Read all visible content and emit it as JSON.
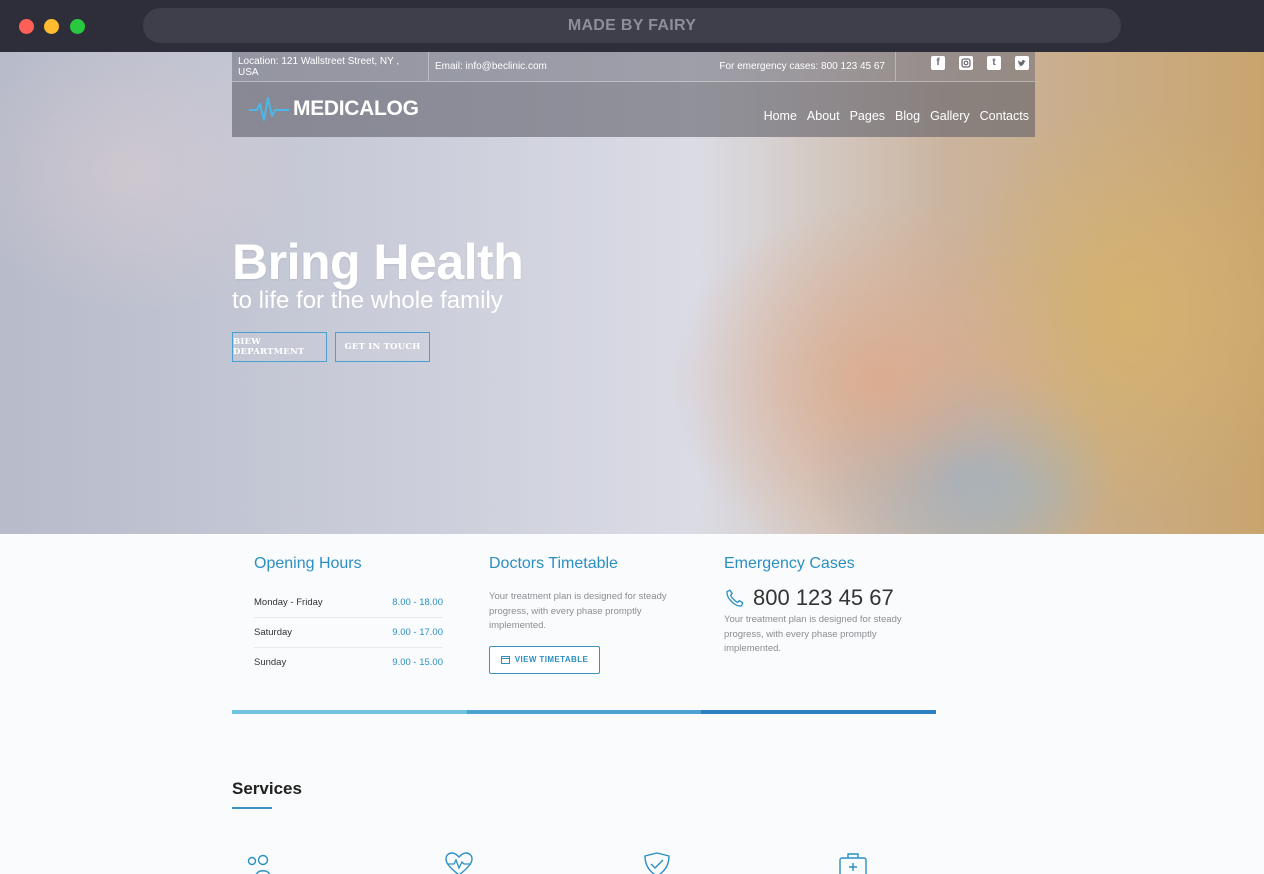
{
  "browser": {
    "address_text": "MADE BY FAIRY"
  },
  "topbar": {
    "location": "Location: 121 Wallstreet Street, NY , USA",
    "email": "Email: info@beclinic.com",
    "emergency": "For emergency cases: 800 123 45 67",
    "socials": [
      "facebook-icon",
      "instagram-icon",
      "tumblr-icon",
      "twitter-icon"
    ]
  },
  "nav": {
    "logo_text": "MEDICALOG",
    "items": [
      "Home",
      "About",
      "Pages",
      "Blog",
      "Gallery",
      "Contacts"
    ]
  },
  "hero": {
    "title": "Bring Health",
    "subtitle": "to life for the whole family",
    "button1": "BIEW DEPARTMENT",
    "button2": "GET IN TOUCH"
  },
  "opening_hours": {
    "title": "Opening Hours",
    "rows": [
      {
        "day": "Monday - Friday",
        "time": "8.00 - 18.00"
      },
      {
        "day": "Saturday",
        "time": "9.00 - 17.00"
      },
      {
        "day": "Sunday",
        "time": "9.00 - 15.00"
      }
    ]
  },
  "timetable": {
    "title": "Doctors Timetable",
    "text": "Your treatment plan is designed for steady progress, with every phase promptly implemented.",
    "button": "VIEW TIMETABLE"
  },
  "emergency": {
    "title": "Emergency Cases",
    "phone": "800 123 45 67",
    "text": "Your treatment plan is designed for steady progress, with every phase promptly implemented."
  },
  "divider_colors": [
    "#6fc2e0",
    "#4aa3d3",
    "#2f7fc0"
  ],
  "services": {
    "title": "Services",
    "icons": [
      "people-icon",
      "heart-pulse-icon",
      "shield-check-icon",
      "medical-kit-icon"
    ]
  },
  "colors": {
    "accent": "#2b8fc2",
    "chrome": "#2d2e39"
  }
}
